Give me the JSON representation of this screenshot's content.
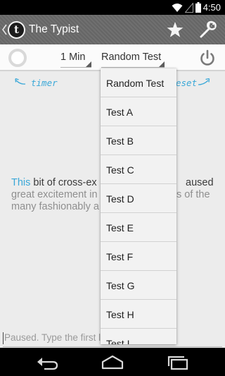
{
  "status_bar": {
    "time": "4:50"
  },
  "action_bar": {
    "logo_letter": "t",
    "title": "The Typist"
  },
  "toolbar": {
    "duration_value": "1 Min",
    "test_value": "Random Test"
  },
  "hints": {
    "timer": "timer",
    "reset": "eset"
  },
  "passage": {
    "typed": "This",
    "current": " bit of cross-ex",
    "current_tail": "aused",
    "line2_start": "great excitement in",
    "line2_end": "s of the",
    "line3_start": "many fashionably a"
  },
  "input": {
    "placeholder": "Paused. Type the first le"
  },
  "dropdown": {
    "options": [
      "Random Test",
      "Test A",
      "Test B",
      "Test C",
      "Test D",
      "Test E",
      "Test F",
      "Test G",
      "Test H",
      "Test I"
    ]
  },
  "colors": {
    "accent": "#3aa8d8",
    "action_bar": "#6a6a6a",
    "background": "#ececec"
  }
}
